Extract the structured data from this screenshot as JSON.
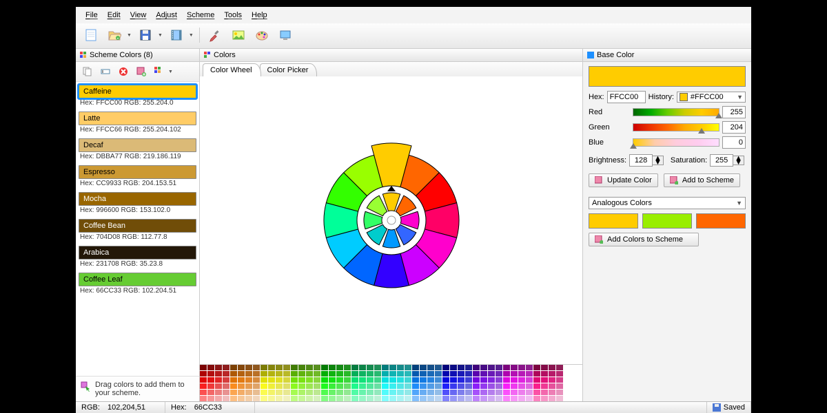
{
  "menu": [
    "File",
    "Edit",
    "View",
    "Adjust",
    "Scheme",
    "Tools",
    "Help"
  ],
  "sections": {
    "scheme": "Scheme Colors (8)",
    "colors": "Colors",
    "base": "Base Color"
  },
  "tabs": {
    "wheel": "Color Wheel",
    "picker": "Color Picker"
  },
  "scheme_colors": [
    {
      "name": "Caffeine",
      "hex": "FFCC00",
      "rgb": "255.204.0",
      "bg": "#FFCC00",
      "fg": "#000",
      "selected": true
    },
    {
      "name": "Latte",
      "hex": "FFCC66",
      "rgb": "255.204.102",
      "bg": "#FFCC66",
      "fg": "#000"
    },
    {
      "name": "Decaf",
      "hex": "DBBA77",
      "rgb": "219.186.119",
      "bg": "#DBBA77",
      "fg": "#000"
    },
    {
      "name": "Espresso",
      "hex": "CC9933",
      "rgb": "204.153.51",
      "bg": "#CC9933",
      "fg": "#000"
    },
    {
      "name": "Mocha",
      "hex": "996600",
      "rgb": "153.102.0",
      "bg": "#996600",
      "fg": "#fff"
    },
    {
      "name": "Coffee Bean",
      "hex": "704D08",
      "rgb": "112.77.8",
      "bg": "#704D08",
      "fg": "#fff"
    },
    {
      "name": "Arabica",
      "hex": "231708",
      "rgb": "35.23.8",
      "bg": "#231708",
      "fg": "#fff"
    },
    {
      "name": "Coffee Leaf",
      "hex": "66CC33",
      "rgb": "102.204.51",
      "bg": "#66CC33",
      "fg": "#000"
    }
  ],
  "hint": "Drag colors to add them to your scheme.",
  "base": {
    "hex": "FFCC00",
    "history_label": "History:",
    "history_value": "#FFCC00",
    "hex_label": "Hex:",
    "red_label": "Red",
    "green_label": "Green",
    "blue_label": "Blue",
    "red": 255,
    "green": 204,
    "blue": 0,
    "brightness_label": "Brightness:",
    "brightness": 128,
    "saturation_label": "Saturation:",
    "saturation": 255,
    "update_btn": "Update Color",
    "add_btn": "Add to Scheme",
    "scheme_type": "Analogous Colors",
    "analogous": [
      "#FFCC00",
      "#99EE00",
      "#FF6600"
    ],
    "add_colors_btn": "Add Colors to Scheme"
  },
  "wheel_segments": [
    "#FFCC00",
    "#FF6600",
    "#FF0000",
    "#FF0066",
    "#FF00CC",
    "#CC00FF",
    "#3300FF",
    "#0066FF",
    "#00CCFF",
    "#00FF99",
    "#33FF00",
    "#99FF00"
  ],
  "wheel_inner": [
    "#FFCC00",
    "#FF6600",
    "#FF00CC",
    "#3366FF",
    "#0099FF",
    "#00CCCC",
    "#33FF66",
    "#99FF33"
  ],
  "status": {
    "rgb_label": "RGB:",
    "rgb": "102,204,51",
    "hex_label": "Hex:",
    "hex": "66CC33",
    "saved": "Saved"
  }
}
